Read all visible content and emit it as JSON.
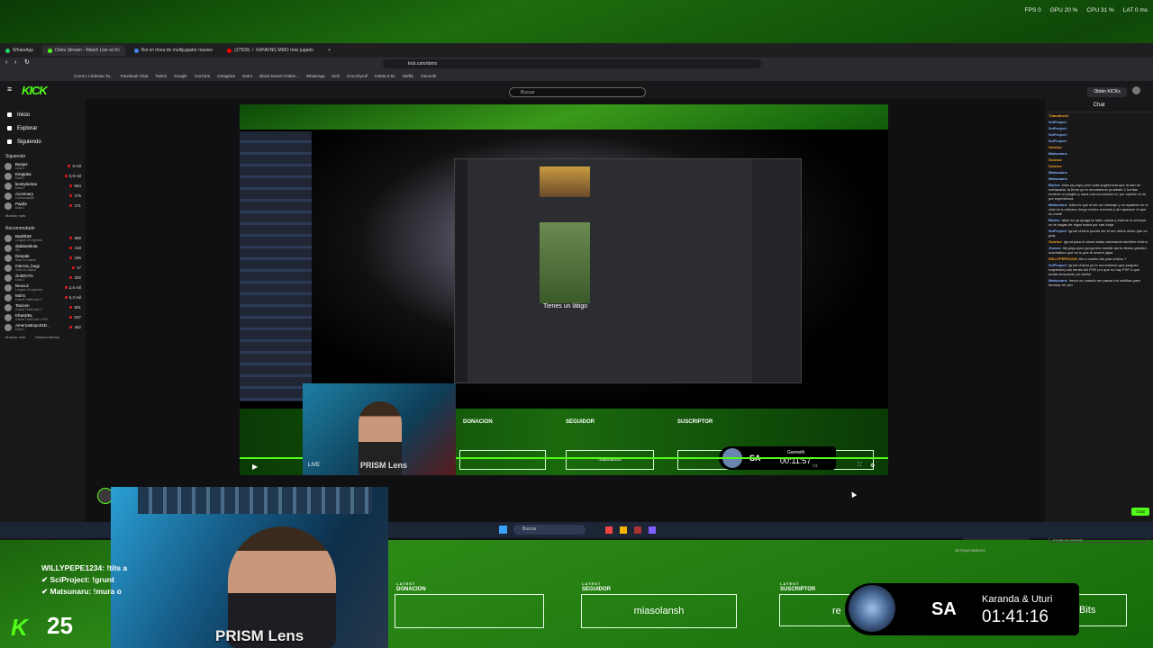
{
  "overlay_stats": [
    "FPS 0",
    "GPU 20 %",
    "CPU 31 %",
    "LAT 0 ms"
  ],
  "tabs": [
    "WhatsApp",
    "Dotro Stream - Watch Live on Ki",
    "Rol en línea de multijugador masivo",
    "(27509) ✓ RANKING MMO más jugado"
  ],
  "url": "kick.com/dotro",
  "bookmarks": [
    "Correo: Lhdrman Ta...",
    "Facebook Chat",
    "Twitch",
    "Google",
    "YouTube",
    "Instagram",
    "Dotro",
    "Black Desert Online...",
    "WhatsApp",
    "Kick",
    "Crunchyroll",
    "Fuleta 5-8o",
    "Netflix",
    "Gennoth"
  ],
  "kick": {
    "logo": "KICK",
    "search_placeholder": "Buscar",
    "get_kicks": "Obtén KICKs"
  },
  "sidebar": {
    "nav": [
      "Inicio",
      "Explorar",
      "Siguiendo"
    ],
    "following_title": "Siguiendo",
    "following": [
      {
        "name": "Banjaz",
        "game": "Dota 2",
        "viewers": "5 mil"
      },
      {
        "name": "Kingtaka",
        "game": "Dota 2",
        "viewers": "3,9 mil"
      },
      {
        "name": "leostyledota",
        "game": "Dota 2",
        "viewers": "584"
      },
      {
        "name": "Accemary",
        "game": "Conversando",
        "viewers": "475"
      },
      {
        "name": "Papita",
        "game": "Dota 2",
        "viewers": "471"
      }
    ],
    "show_more": "Mostrar más",
    "recommended_title": "Recomendado",
    "recommended": [
      {
        "name": "Badrik28",
        "game": "League of Legends",
        "viewers": "588"
      },
      {
        "name": "diablaotdota",
        "game": "IRL",
        "viewers": "419"
      },
      {
        "name": "Deepak",
        "game": "Slots & Casino",
        "viewers": "196"
      },
      {
        "name": "marcos_bugy",
        "game": "Slots & Casino",
        "viewers": "17"
      },
      {
        "name": "zlokDOTA",
        "game": "Dota 2",
        "viewers": "202"
      },
      {
        "name": "Nexxuz",
        "game": "League of Legends",
        "viewers": "2,5 mil"
      },
      {
        "name": "M2rG",
        "game": "Grand Theft Auto V",
        "viewers": "6,3 mil"
      },
      {
        "name": "Tanizen",
        "game": "Grand Theft Auto V",
        "viewers": "601"
      },
      {
        "name": "KhanDBL",
        "game": "Grand Theft Auto V RO...",
        "viewers": "537"
      },
      {
        "name": "AmericaEsportsD...",
        "game": "Dota 2",
        "viewers": "462"
      }
    ],
    "show_more_2": "Mostrar más",
    "show_less": "Mostrar Menos"
  },
  "video": {
    "discord_caption": "Tienes un látigo",
    "prism_small": "PRISM Lens",
    "live_label": "LIVE",
    "labels": [
      "DONACION",
      "SEGUIDOR",
      "SUSCRIPTOR"
    ],
    "follower_name": "miasolansh",
    "sa": "SA",
    "timer_name": "Garmoth",
    "timer": "00:11:57"
  },
  "chat": {
    "title": "Chat",
    "messages": [
      {
        "user": "Thanatho22",
        "text": ""
      },
      {
        "user": "SciProject:",
        "text": ""
      },
      {
        "user": "SciProject:",
        "text": ""
      },
      {
        "user": "SciProject:",
        "text": ""
      },
      {
        "user": "SciProject:",
        "text": ""
      },
      {
        "user": "Goiziuz:",
        "text": ""
      },
      {
        "user": "Matsunaru:",
        "text": ""
      },
      {
        "user": "Goiziuz:",
        "text": ""
      },
      {
        "user": "Goiziuz:",
        "text": ""
      },
      {
        "user": "Matsunaru:",
        "text": ""
      },
      {
        "user": "Matsunaru:",
        "text": ""
      },
      {
        "user": "Biolen:",
        "text": "loiko ya papu pero toda sugerencia que la dan es rechazada, la firma ya te recomiendo pruebale 2 horitas mínimo un juegito y saca una conclusión no por opinión si no por experiencia"
      },
      {
        "user": "Matsunaru:",
        "text": "loiko es que envió un mensaje y no aparece en el chat en tu stream, luego vuelvo a enviar y ahí aparece el que no envié"
      },
      {
        "user": "Biolen:",
        "text": "talon se ya apaga la radio causa y traume el crimson no te hagas de rogar hasta por san borja"
      },
      {
        "user": "SciProject:",
        "text": "!grunt chicho puede ser el arc riders dicen que es goty"
      },
      {
        "user": "Goiziuz:",
        "text": "!grunt para el ahora estas webeando también chicho"
      },
      {
        "user": "Jhezuz:",
        "text": "tits papu pero juega bdo mobile así tu tienes grindeo automático que es lo que te aburre jajaa"
      },
      {
        "user": "WILLYPEPE1234:",
        "text": "tits a cuanto las joas chicho ?"
      },
      {
        "user": "SciProject:",
        "text": "!grunt chicho yo te recomiendo que juegues maplestory así tienes full PVE por que no hay PVP o que andas buscando ps chicho"
      },
      {
        "user": "Matsunaru:",
        "text": "!mura oe cuando me pasas tus multitas para farmear mi zen"
      }
    ],
    "gift": "Regala Suscripciones",
    "viewers": "25 Espectadores",
    "send_placeholder": "Enviar un mensaje",
    "chat_button": "Chat"
  },
  "taskbar": {
    "search": "Buscar"
  },
  "stream_overlay": {
    "prism": "PRISM Lens",
    "chat_lines": [
      {
        "user": "WILLYPEPE1234:",
        "text": "!tits a"
      },
      {
        "user": "SciProject:",
        "text": "!grunt"
      },
      {
        "user": "Matsunaru:",
        "text": "!mura o"
      }
    ],
    "count": "25",
    "latest": "LATEST",
    "donacion": "DONACION",
    "seguidor": "SEGUIDOR",
    "suscriptor": "SUSCRIPTOR",
    "follower_name": "miasolansh",
    "sub_partial": "re",
    "bits": "Bits",
    "sa": "SA",
    "timer_name": "Karanda & Uturi",
    "timer": "01:41:16"
  }
}
